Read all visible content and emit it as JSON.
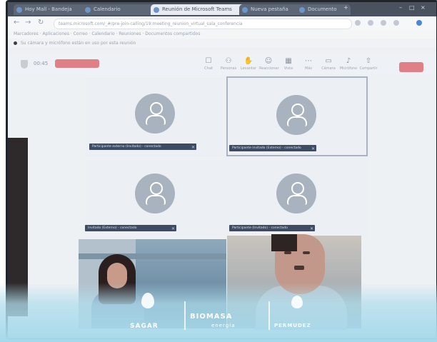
{
  "browser": {
    "tabs": [
      {
        "label": "Hoy Mall - Bandeja",
        "active": false
      },
      {
        "label": "Calendario",
        "active": false
      },
      {
        "label": "Reunión de Microsoft Teams",
        "active": true
      },
      {
        "label": "Nueva pestaña",
        "active": false
      },
      {
        "label": "Documento",
        "active": false
      }
    ],
    "url": "teams.microsoft.com/_#/pre-join-calling/19:meeting_reunion_virtual_sala_conferencia",
    "bookmarks": "Marcadores · Aplicaciones · Correo · Calendario · Reuniones · Documentos compartidos",
    "notice": "Su cámara y micrófono están en uso por esta reunión"
  },
  "meeting_toolbar": {
    "timer": "00:45",
    "controls": [
      {
        "icon": "chat-icon",
        "glyph": "☐",
        "label": "Chat"
      },
      {
        "icon": "people-icon",
        "glyph": "⚇",
        "label": "Personas"
      },
      {
        "icon": "raise-hand-icon",
        "glyph": "✋",
        "label": "Levantar"
      },
      {
        "icon": "react-icon",
        "glyph": "☺",
        "label": "Reaccionar"
      },
      {
        "icon": "view-icon",
        "glyph": "▦",
        "label": "Vista"
      },
      {
        "icon": "more-icon",
        "glyph": "⋯",
        "label": "Más"
      },
      {
        "icon": "camera-icon",
        "glyph": "▭",
        "label": "Cámara"
      },
      {
        "icon": "mic-icon",
        "glyph": "♪",
        "label": "Micrófono"
      },
      {
        "icon": "share-icon",
        "glyph": "⇧",
        "label": "Compartir"
      }
    ]
  },
  "participants": [
    {
      "name": "Participante externo (Invitado) - conectado"
    },
    {
      "name": "Participante invitado (Externo) - conectado"
    },
    {
      "name": "Invitado (Externo) - conectado"
    },
    {
      "name": "Participante (Invitado) - conectado"
    }
  ],
  "banner": {
    "logo_left": "SAGAR",
    "logo_center": "BIOMASA",
    "logo_center_sub": "energía",
    "logo_right": "PERMUDEZ"
  },
  "colors": {
    "leave_button": "#e07f86",
    "name_tag": "#3d4b63",
    "avatar": "#a9b3c0"
  }
}
